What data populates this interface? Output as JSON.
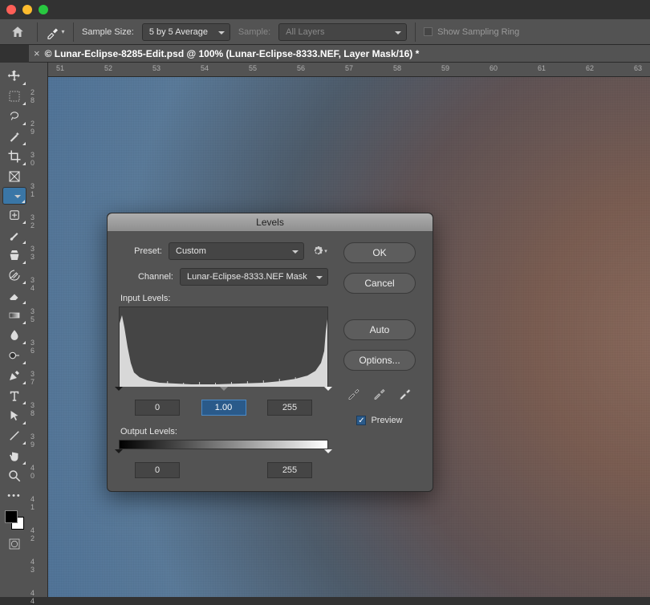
{
  "window": {
    "traffic": [
      "close",
      "min",
      "max"
    ]
  },
  "topbar": {
    "sample_size_label": "Sample Size:",
    "sample_size_value": "5 by 5 Average",
    "sample_label": "Sample:",
    "sample_value": "All Layers",
    "show_ring": "Show Sampling Ring"
  },
  "tab": {
    "title": "© Lunar-Eclipse-8285-Edit.psd @ 100% (Lunar-Eclipse-8333.NEF, Layer Mask/16) *"
  },
  "ruler_h": [
    "51",
    "52",
    "53",
    "54",
    "55",
    "56",
    "57",
    "58",
    "59",
    "60",
    "61",
    "62",
    "63"
  ],
  "ruler_v": [
    "28",
    "29",
    "30",
    "31",
    "32",
    "33",
    "34",
    "35",
    "36",
    "37",
    "38",
    "39",
    "40",
    "41",
    "42",
    "43",
    "44"
  ],
  "tools": [
    "move",
    "marquee",
    "lasso",
    "wand",
    "crop",
    "frame",
    "eyedropper",
    "patch",
    "brush",
    "stamp",
    "history-brush",
    "eraser",
    "gradient",
    "blur",
    "dodge",
    "pen",
    "type",
    "path-select",
    "line",
    "hand",
    "zoom",
    "more"
  ],
  "dialog": {
    "title": "Levels",
    "preset_label": "Preset:",
    "preset_value": "Custom",
    "channel_label": "Channel:",
    "channel_value": "Lunar-Eclipse-8333.NEF Mask",
    "input_label": "Input Levels:",
    "output_label": "Output Levels:",
    "in_black": "0",
    "in_gamma": "1.00",
    "in_white": "255",
    "out_black": "0",
    "out_white": "255",
    "ok": "OK",
    "cancel": "Cancel",
    "auto": "Auto",
    "options": "Options...",
    "preview": "Preview"
  }
}
